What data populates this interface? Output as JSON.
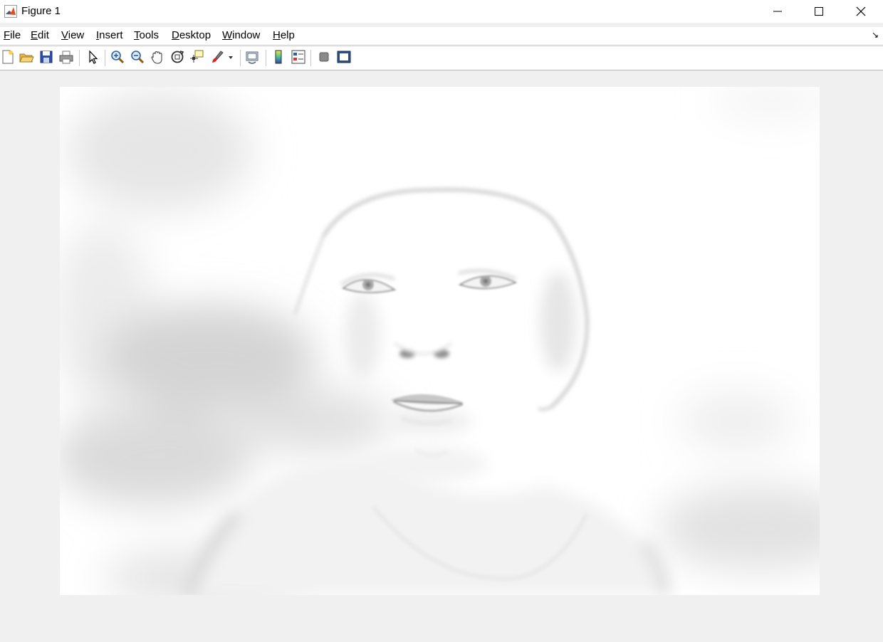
{
  "window": {
    "title": "Figure 1",
    "minimize_icon": "minimize-icon",
    "maximize_icon": "maximize-icon",
    "close_icon": "close-icon"
  },
  "menu": {
    "items": [
      {
        "mnemonic": "F",
        "rest": "ile"
      },
      {
        "mnemonic": "E",
        "rest": "dit"
      },
      {
        "mnemonic": "V",
        "rest": "iew"
      },
      {
        "mnemonic": "I",
        "rest": "nsert"
      },
      {
        "mnemonic": "T",
        "rest": "ools"
      },
      {
        "mnemonic": "D",
        "rest": "esktop"
      },
      {
        "mnemonic": "W",
        "rest": "indow"
      },
      {
        "mnemonic": "H",
        "rest": "elp"
      }
    ],
    "dock_icon": "dock-figure-icon"
  },
  "toolbar": {
    "icons": [
      "new-figure-icon",
      "open-file-icon",
      "save-figure-icon",
      "print-figure-icon",
      "edit-plot-icon",
      "zoom-in-icon",
      "zoom-out-icon",
      "pan-icon",
      "rotate-3d-icon",
      "data-cursor-icon",
      "brush-icon",
      "link-plot-icon",
      "insert-colorbar-icon",
      "insert-legend-icon",
      "hide-plot-tools-icon",
      "show-plot-tools-icon"
    ]
  },
  "image": {
    "content": "faded-grayscale-photo-of-child-portrait",
    "background_color": "#ffffff"
  },
  "colors": {
    "window_bg": "#f0f0f0",
    "titlebar_bg": "#ffffff",
    "matlab_icon": "#d9531e"
  }
}
